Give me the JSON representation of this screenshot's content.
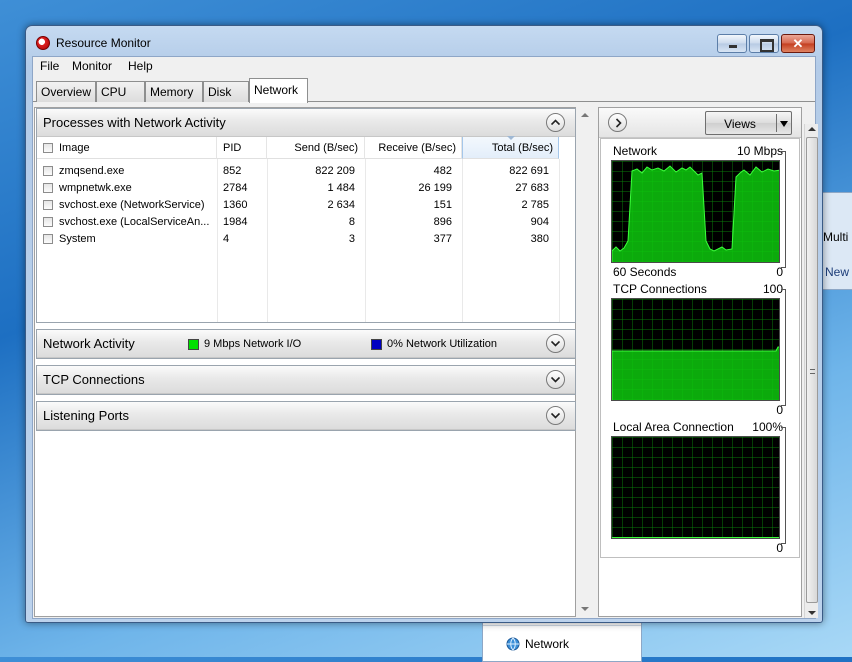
{
  "window": {
    "title": "Resource Monitor",
    "close_glyph": "✕",
    "menu": [
      "File",
      "Monitor",
      "Help"
    ],
    "tabs": [
      {
        "label": "Overview",
        "active": false
      },
      {
        "label": "CPU",
        "active": false
      },
      {
        "label": "Memory",
        "active": false
      },
      {
        "label": "Disk",
        "active": false
      },
      {
        "label": "Network",
        "active": true
      }
    ]
  },
  "processes": {
    "title": "Processes with Network Activity",
    "columns": [
      "Image",
      "PID",
      "Send (B/sec)",
      "Receive (B/sec)",
      "Total (B/sec)"
    ],
    "sorted_column": "Total (B/sec)",
    "rows": [
      {
        "image": "zmqsend.exe",
        "pid": "852",
        "send": "822 209",
        "receive": "482",
        "total": "822 691"
      },
      {
        "image": "wmpnetwk.exe",
        "pid": "2784",
        "send": "1 484",
        "receive": "26 199",
        "total": "27 683"
      },
      {
        "image": "svchost.exe (NetworkService)",
        "pid": "1360",
        "send": "2 634",
        "receive": "151",
        "total": "2 785"
      },
      {
        "image": "svchost.exe (LocalServiceAn...",
        "pid": "1984",
        "send": "8",
        "receive": "896",
        "total": "904"
      },
      {
        "image": "System",
        "pid": "4",
        "send": "3",
        "receive": "377",
        "total": "380"
      }
    ]
  },
  "network_activity": {
    "title": "Network Activity",
    "io_label": "9 Mbps Network I/O",
    "io_color": "#00e000",
    "util_label": "0% Network Utilization",
    "util_color": "#0000c0"
  },
  "tcp_connections": {
    "title": "TCP Connections"
  },
  "listening_ports": {
    "title": "Listening Ports"
  },
  "right_panel": {
    "views_label": "Views",
    "graphs": [
      {
        "title": "Network",
        "max": "10 Mbps",
        "footer_left": "60 Seconds",
        "footer_right": "0"
      },
      {
        "title": "TCP Connections",
        "max": "100",
        "footer_left": "",
        "footer_right": "0"
      },
      {
        "title": "Local Area Connection",
        "max": "100%",
        "footer_left": "",
        "footer_right": "0"
      }
    ]
  },
  "background": {
    "right_window_text1": "Multi",
    "right_window_text2": "New",
    "bottom_window_label": "Network"
  },
  "icons": {
    "app": "resource-monitor-icon",
    "minimize": "minimize-icon",
    "maximize": "maximize-icon",
    "close": "close-icon",
    "collapse": "chevron-up-icon",
    "expand": "chevron-down-icon",
    "panel_toggle": "chevron-right-icon",
    "dropdown": "dropdown-arrow-icon",
    "network": "network-icon"
  }
}
